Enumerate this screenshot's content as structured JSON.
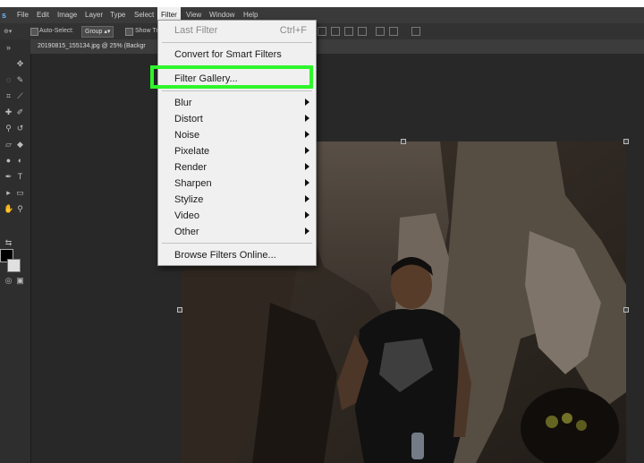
{
  "menubar": {
    "app_logo": "s",
    "items": [
      "File",
      "Edit",
      "Image",
      "Layer",
      "Type",
      "Select",
      "Filter",
      "View",
      "Window",
      "Help"
    ],
    "active": "Filter"
  },
  "options_bar": {
    "auto_select_label": "Auto-Select:",
    "auto_select_value": "Group",
    "show_transform_label": "Show Tr"
  },
  "document": {
    "tab_title": "20190815_155134.jpg @ 25% (Backgr"
  },
  "filter_menu": {
    "last_filter": {
      "label": "Last Filter",
      "shortcut": "Ctrl+F"
    },
    "convert_smart": "Convert for Smart Filters",
    "filter_gallery": "Filter Gallery...",
    "submenus": [
      "Blur",
      "Distort",
      "Noise",
      "Pixelate",
      "Render",
      "Sharpen",
      "Stylize",
      "Video",
      "Other"
    ],
    "browse_online": "Browse Filters Online..."
  },
  "colors": {
    "highlight": "#2ef52a",
    "menu_bg": "#f0f0f0",
    "app_bg": "#262626"
  }
}
